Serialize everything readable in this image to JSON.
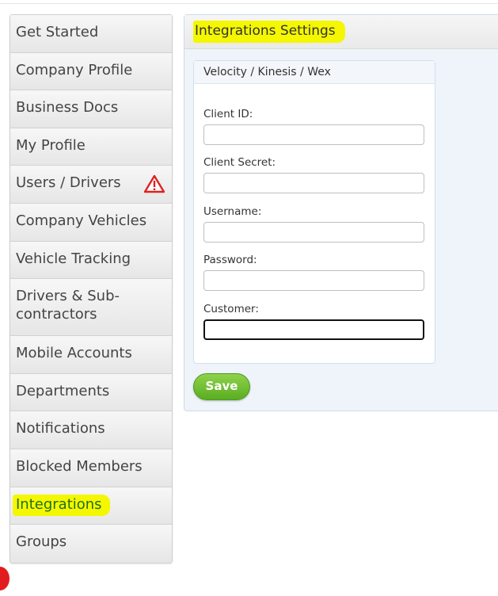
{
  "sidebar": {
    "items": [
      {
        "label": "Get Started"
      },
      {
        "label": "Company Profile"
      },
      {
        "label": "Business Docs"
      },
      {
        "label": "My Profile"
      },
      {
        "label": "Users / Drivers",
        "icon": "warning-icon"
      },
      {
        "label": "Company Vehicles"
      },
      {
        "label": "Vehicle Tracking"
      },
      {
        "label": "Drivers & Sub-contractors"
      },
      {
        "label": "Mobile Accounts"
      },
      {
        "label": "Departments"
      },
      {
        "label": "Notifications"
      },
      {
        "label": "Blocked Members"
      },
      {
        "label": "Integrations",
        "active": true
      },
      {
        "label": "Groups"
      }
    ]
  },
  "panel": {
    "title": "Integrations Settings",
    "section_title": "Velocity / Kinesis / Wex",
    "fields": [
      {
        "label": "Client ID:",
        "value": ""
      },
      {
        "label": "Client Secret:",
        "value": ""
      },
      {
        "label": "Username:",
        "value": ""
      },
      {
        "label": "Password:",
        "value": ""
      },
      {
        "label": "Customer:",
        "value": ""
      }
    ],
    "save_label": "Save"
  },
  "colors": {
    "highlight": "#f4f700",
    "save_green": "#6bbf2c",
    "warning_red": "#e02020"
  }
}
